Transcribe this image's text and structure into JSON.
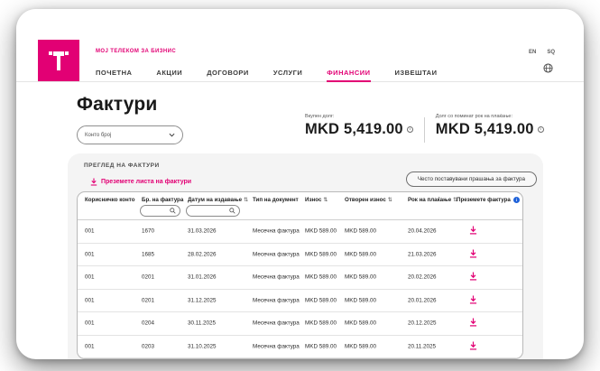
{
  "brand": {
    "portal_label": "МОЈ ТЕЛЕКОМ ЗА БИЗНИС",
    "accent_color": "#e20074"
  },
  "nav": {
    "items": [
      {
        "label": "ПОЧЕТНА"
      },
      {
        "label": "АКЦИИ"
      },
      {
        "label": "ДОГОВОРИ"
      },
      {
        "label": "УСЛУГИ"
      },
      {
        "label": "ФИНАНСИИ"
      },
      {
        "label": "ИЗВЕШТАИ"
      }
    ],
    "active_item": "ФИНАНСИИ",
    "languages": [
      {
        "label": "EN"
      },
      {
        "label": "SQ"
      }
    ]
  },
  "page": {
    "title": "Фактури",
    "account_select": {
      "placeholder": "Конто број"
    },
    "debts": [
      {
        "label": "Вкупен долг:",
        "amount": "MKD 5,419.00"
      },
      {
        "label": "Долг со поминат рок на плаќање:",
        "amount": "MKD 5,419.00"
      }
    ]
  },
  "panel": {
    "title": "ПРЕГЛЕД НА ФАКТУРИ",
    "download_list_link": "Преземете листа на фактури",
    "faq_button": "Често поставувани прашања за фактура"
  },
  "table": {
    "columns": [
      "Корисничко конто",
      "Бр. на фактура",
      "Датум на издавање",
      "Тип на документ",
      "Износ",
      "Отворен износ",
      "Рок на плаќање",
      "Преземете фактура"
    ],
    "sortable_columns": [
      "Датум на издавање",
      "Износ",
      "Отворен износ",
      "Рок на плаќање"
    ],
    "filters": [
      {
        "column": "Бр. на фактура",
        "value": ""
      },
      {
        "column": "Датум на издавање",
        "value": ""
      }
    ],
    "rows": [
      {
        "account": "001",
        "invoice_no": "1670",
        "issue_date": "31.03.2026",
        "doc_type": "Месечна фактура",
        "amount": "MKD 589.00",
        "open_amount": "MKD 589.00",
        "due_date": "20.04.2026"
      },
      {
        "account": "001",
        "invoice_no": "1685",
        "issue_date": "28.02.2026",
        "doc_type": "Месечна фактура",
        "amount": "MKD 589.00",
        "open_amount": "MKD 589.00",
        "due_date": "21.03.2026"
      },
      {
        "account": "001",
        "invoice_no": "0201",
        "issue_date": "31.01.2026",
        "doc_type": "Месечна фактура",
        "amount": "MKD 589.00",
        "open_amount": "MKD 589.00",
        "due_date": "20.02.2026"
      },
      {
        "account": "001",
        "invoice_no": "0201",
        "issue_date": "31.12.2025",
        "doc_type": "Месечна фактура",
        "amount": "MKD 589.00",
        "open_amount": "MKD 589.00",
        "due_date": "20.01.2026"
      },
      {
        "account": "001",
        "invoice_no": "0204",
        "issue_date": "30.11.2025",
        "doc_type": "Месечна фактура",
        "amount": "MKD 589.00",
        "open_amount": "MKD 589.00",
        "due_date": "20.12.2025"
      },
      {
        "account": "001",
        "invoice_no": "0203",
        "issue_date": "31.10.2025",
        "doc_type": "Месечна фактура",
        "amount": "MKD 589.00",
        "open_amount": "MKD 589.00",
        "due_date": "20.11.2025"
      }
    ]
  }
}
